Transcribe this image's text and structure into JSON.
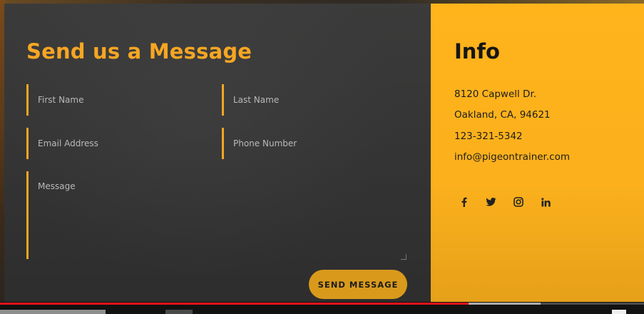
{
  "form": {
    "title": "Send us a Message",
    "fields": {
      "first_name": {
        "placeholder": "First Name",
        "value": ""
      },
      "last_name": {
        "placeholder": "Last Name",
        "value": ""
      },
      "email": {
        "placeholder": "Email Address",
        "value": ""
      },
      "phone": {
        "placeholder": "Phone Number",
        "value": ""
      },
      "message": {
        "placeholder": "Message",
        "value": ""
      }
    },
    "submit_label": "SEND MESSAGE"
  },
  "info": {
    "title": "Info",
    "lines": [
      "8120 Capwell Dr.",
      "Oakland, CA, 94621",
      "123-321-5342",
      "info@pigeontrainer.com"
    ],
    "social_icons": [
      "facebook-icon",
      "twitter-icon",
      "instagram-icon",
      "linkedin-icon"
    ]
  },
  "video": {
    "played_fraction": 0.728,
    "buffered_fraction": 0.839
  },
  "colors": {
    "accent": "#f6a623",
    "info_panel": "#ffb41c",
    "button": "#d99a1c",
    "form_panel": "#323232",
    "progress": "#e3141b"
  }
}
